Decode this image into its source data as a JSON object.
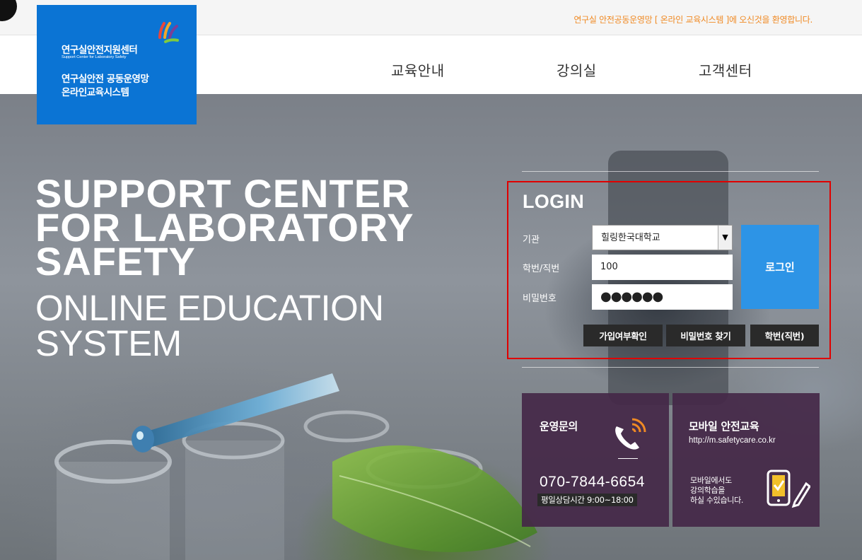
{
  "header": {
    "welcome": "연구실 안전공동운영망 [ 온라인 교육시스템 ]에 오신것을 환영합니다.",
    "nav": [
      "교육안내",
      "강의실",
      "고객센터"
    ]
  },
  "logo": {
    "title": "연구실안전지원센터",
    "subtitle": "Support Center for Laboratory Safety",
    "line1": "연구실안전 공동운영망",
    "line2": "온라인교육시스템",
    "mark_colors": [
      "#e9463a",
      "#f2a62a",
      "#7fcb3f",
      "#7a3f98"
    ]
  },
  "hero": {
    "lines_bold": [
      "SUPPORT CENTER",
      "FOR LABORATORY",
      "SAFETY"
    ],
    "lines_light": [
      "ONLINE EDUCATION",
      "SYSTEM"
    ]
  },
  "login": {
    "title": "LOGIN",
    "org_label": "기관",
    "org_value": "힐링한국대학교",
    "id_label": "학번/직번",
    "id_value": "100",
    "pw_label": "비밀번호",
    "pw_value": "●●●●●●",
    "submit": "로그인",
    "buttons": [
      "가입여부확인",
      "비밀번호 찾기",
      "학번(직번)"
    ],
    "accent": "#2d94e6",
    "highlight": "#e00000"
  },
  "contact": {
    "title": "운영문의",
    "phone": "070-7844-6654",
    "hours": "평일상담시간 9:00~18:00"
  },
  "mobile": {
    "title": "모바일 안전교육",
    "url": "http://m.safetycare.co.kr",
    "desc": [
      "모바일에서도",
      "강의학습을",
      "하실 수있습니다."
    ]
  }
}
